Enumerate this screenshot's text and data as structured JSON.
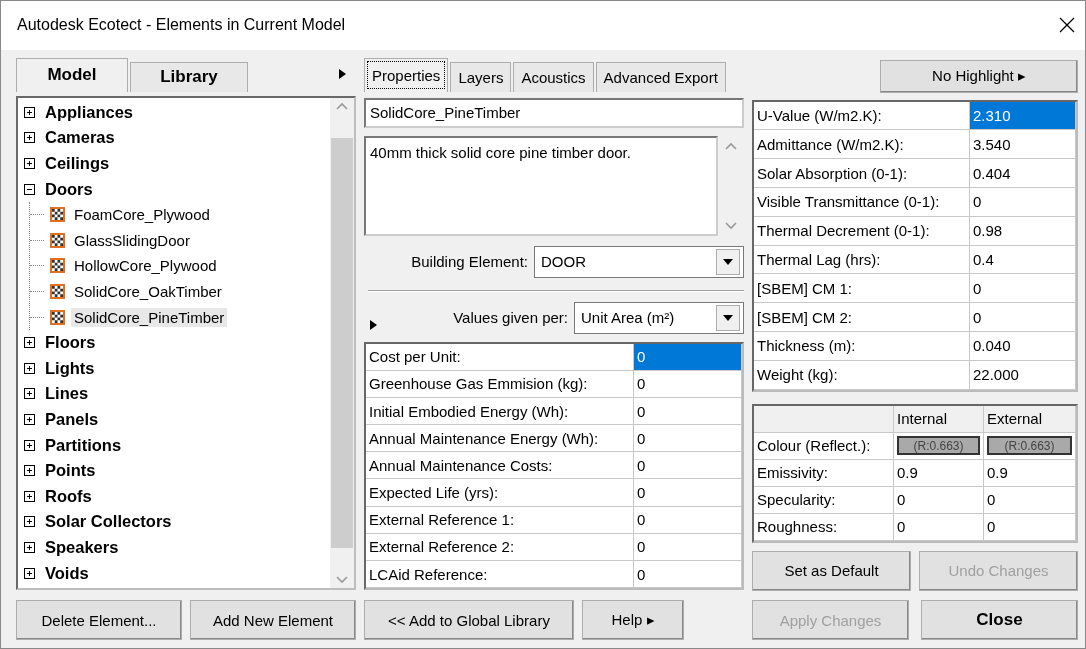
{
  "window": {
    "title": "Autodesk Ecotect - Elements in Current Model"
  },
  "left": {
    "tabs": [
      {
        "label": "Model",
        "selected": true
      },
      {
        "label": "Library",
        "selected": false
      }
    ],
    "tree": [
      {
        "label": "Appliances",
        "expanded": false
      },
      {
        "label": "Cameras",
        "expanded": false
      },
      {
        "label": "Ceilings",
        "expanded": false
      },
      {
        "label": "Doors",
        "expanded": true,
        "children": [
          {
            "label": "FoamCore_Plywood",
            "selected": false
          },
          {
            "label": "GlassSlidingDoor",
            "selected": false
          },
          {
            "label": "HollowCore_Plywood",
            "selected": false
          },
          {
            "label": "SolidCore_OakTimber",
            "selected": false
          },
          {
            "label": "SolidCore_PineTimber",
            "selected": true
          }
        ]
      },
      {
        "label": "Floors",
        "expanded": false
      },
      {
        "label": "Lights",
        "expanded": false
      },
      {
        "label": "Lines",
        "expanded": false
      },
      {
        "label": "Panels",
        "expanded": false
      },
      {
        "label": "Partitions",
        "expanded": false
      },
      {
        "label": "Points",
        "expanded": false
      },
      {
        "label": "Roofs",
        "expanded": false
      },
      {
        "label": "Solar Collectors",
        "expanded": false
      },
      {
        "label": "Speakers",
        "expanded": false
      },
      {
        "label": "Voids",
        "expanded": false
      }
    ],
    "buttons": [
      {
        "label": "Delete Element...",
        "disabled": false
      },
      {
        "label": "Add New Element",
        "disabled": false
      }
    ]
  },
  "middle": {
    "tabs": [
      {
        "label": "Properties",
        "selected": true
      },
      {
        "label": "Layers",
        "selected": false
      },
      {
        "label": "Acoustics",
        "selected": false
      },
      {
        "label": "Advanced Export",
        "selected": false
      }
    ],
    "name": "SolidCore_PineTimber",
    "description": "40mm thick solid core pine timber door.",
    "building_element": {
      "label": "Building Element:",
      "value": "DOOR"
    },
    "values_per": {
      "label": "Values given per:",
      "value": "Unit Area (m²)"
    },
    "cost_rows": [
      {
        "label": "Cost per Unit:",
        "value": "0",
        "selected": true
      },
      {
        "label": "Greenhouse Gas Emmision (kg):",
        "value": "0",
        "selected": false
      },
      {
        "label": "Initial Embodied Energy (Wh):",
        "value": "0",
        "selected": false
      },
      {
        "label": "Annual Maintenance Energy (Wh):",
        "value": "0",
        "selected": false
      },
      {
        "label": "Annual Maintenance Costs:",
        "value": "0",
        "selected": false
      },
      {
        "label": "Expected Life (yrs):",
        "value": "0",
        "selected": false
      },
      {
        "label": "External Reference 1:",
        "value": "0",
        "selected": false
      },
      {
        "label": "External Reference 2:",
        "value": "0",
        "selected": false
      },
      {
        "label": "LCAid Reference:",
        "value": "0",
        "selected": false
      }
    ],
    "buttons": [
      {
        "label": "<< Add to Global Library",
        "disabled": false
      },
      {
        "label": "Help ▸",
        "disabled": false
      }
    ]
  },
  "right": {
    "highlight_button": "No Highlight ▸",
    "properties": [
      {
        "label": "U-Value (W/m2.K):",
        "value": "2.310",
        "selected": true
      },
      {
        "label": "Admittance (W/m2.K):",
        "value": "3.540",
        "selected": false
      },
      {
        "label": "Solar Absorption (0-1):",
        "value": "0.404",
        "selected": false
      },
      {
        "label": "Visible Transmittance (0-1):",
        "value": "0",
        "selected": false
      },
      {
        "label": "Thermal Decrement (0-1):",
        "value": "0.98",
        "selected": false
      },
      {
        "label": "Thermal Lag (hrs):",
        "value": "0.4",
        "selected": false
      },
      {
        "label": "[SBEM] CM 1:",
        "value": "0",
        "selected": false
      },
      {
        "label": "[SBEM] CM 2:",
        "value": "0",
        "selected": false
      },
      {
        "label": "Thickness (m):",
        "value": "0.040",
        "selected": false
      },
      {
        "label": "Weight (kg):",
        "value": "22.000",
        "selected": false
      }
    ],
    "surface": {
      "columns": [
        "Internal",
        "External"
      ],
      "rows": [
        {
          "kind": "swatch",
          "label": "Colour (Reflect.):",
          "internal": "(R:0.663)",
          "external": "(R:0.663)",
          "color": "#a9a9a9"
        },
        {
          "kind": "text",
          "label": "Emissivity:",
          "internal": "0.9",
          "external": "0.9"
        },
        {
          "kind": "text",
          "label": "Specularity:",
          "internal": "0",
          "external": "0"
        },
        {
          "kind": "text",
          "label": "Roughness:",
          "internal": "0",
          "external": "0"
        }
      ]
    },
    "surface_buttons": [
      {
        "label": "Set as Default",
        "disabled": false
      },
      {
        "label": "Undo Changes",
        "disabled": true
      }
    ],
    "buttons": [
      {
        "label": "Apply Changes",
        "disabled": true
      },
      {
        "label": "Close",
        "disabled": false
      }
    ]
  }
}
